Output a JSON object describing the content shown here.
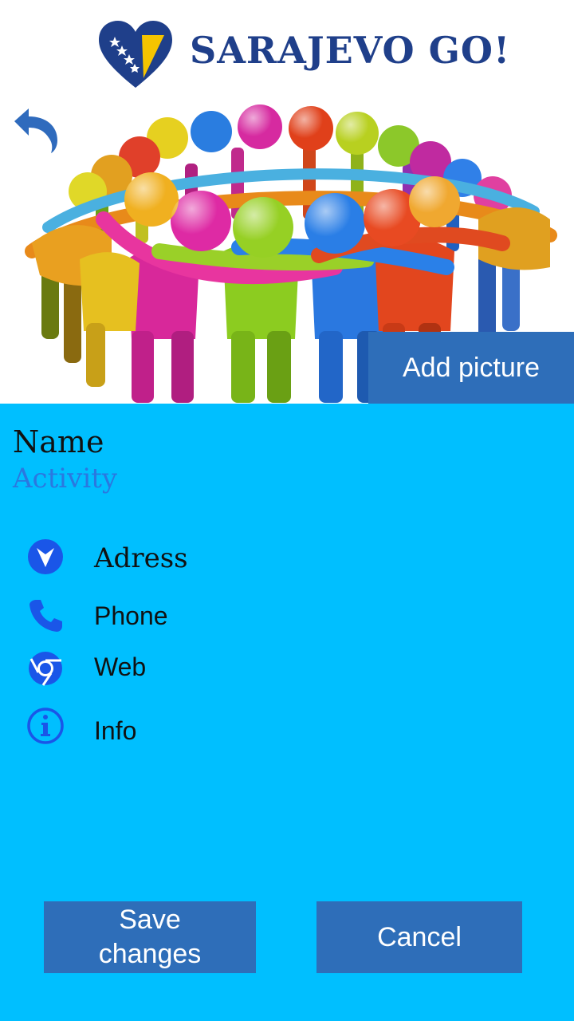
{
  "app": {
    "title": "SARAJEVO GO!"
  },
  "hero": {
    "add_picture_label": "Add picture"
  },
  "place": {
    "name": "Name",
    "activity": "Activity"
  },
  "details": [
    {
      "icon": "location-icon",
      "label": "Adress"
    },
    {
      "icon": "phone-icon",
      "label": "Phone"
    },
    {
      "icon": "web-icon",
      "label": "Web"
    },
    {
      "icon": "info-icon",
      "label": "Info"
    }
  ],
  "actions": {
    "save_label": "Save changes",
    "cancel_label": "Cancel"
  },
  "colors": {
    "background": "#00bfff",
    "button": "#2e6eb9",
    "icon": "#1a56e8",
    "brand": "#1f3f8a"
  }
}
